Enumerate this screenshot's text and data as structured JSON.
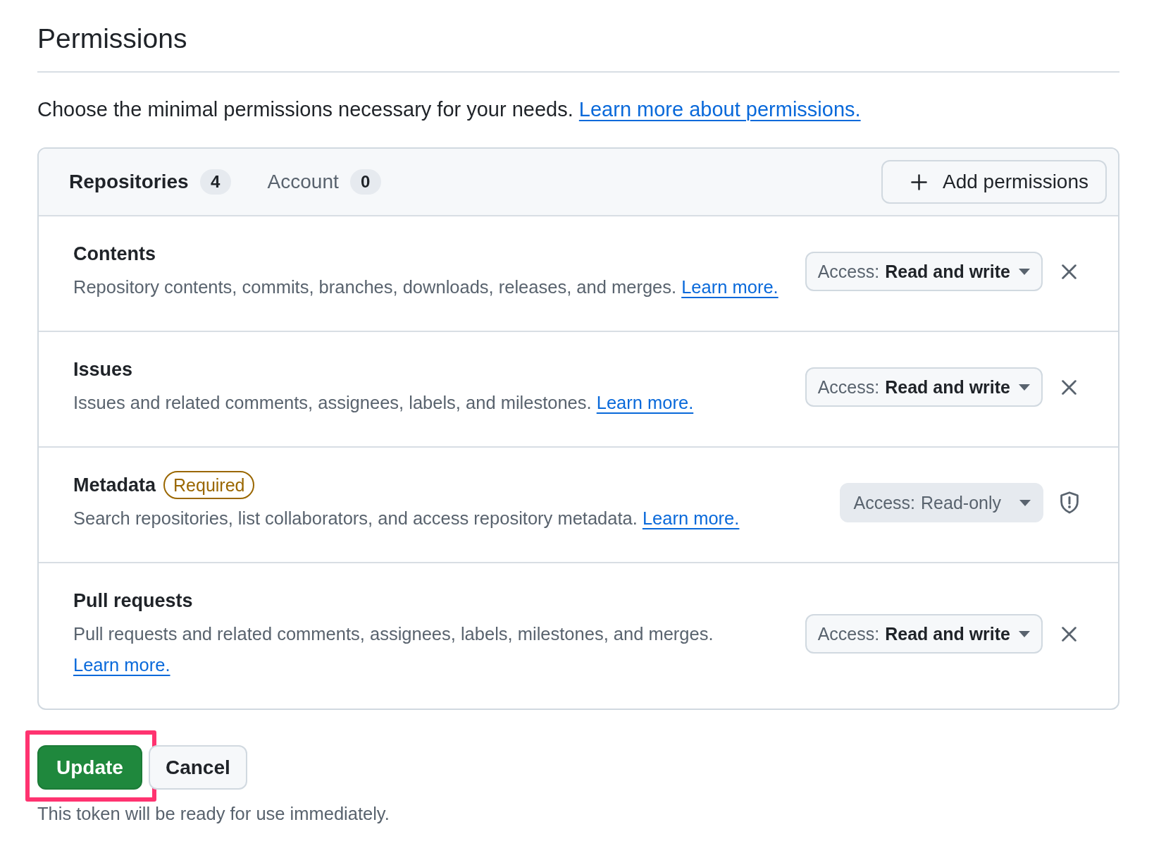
{
  "page": {
    "title": "Permissions",
    "intro": {
      "text": "Choose the minimal permissions necessary for your needs.",
      "link": "Learn more about permissions."
    }
  },
  "panel": {
    "tabs": [
      {
        "label": "Repositories",
        "count": "4",
        "selected": true
      },
      {
        "label": "Account",
        "count": "0",
        "selected": false
      }
    ],
    "add_button": {
      "label": "Add permissions"
    },
    "rows": [
      {
        "name": "Contents",
        "description": "Repository contents, commits, branches, downloads, releases, and merges.",
        "link": "Learn more.",
        "access_prefix": "Access:",
        "access_value": "Read and write",
        "locked": false
      },
      {
        "name": "Issues",
        "description": "Issues and related comments, assignees, labels, and milestones.",
        "link": "Learn more.",
        "access_prefix": "Access:",
        "access_value": "Read and write",
        "locked": false
      },
      {
        "name": "Metadata",
        "badge": "Required",
        "description": "Search repositories, list collaborators, and access repository metadata.",
        "link": "Learn more.",
        "access_prefix": "Access:",
        "access_value": "Read-only",
        "locked": true
      },
      {
        "name": "Pull requests",
        "description": "Pull requests and related comments, assignees, labels, milestones, and merges.",
        "link": "Learn more.",
        "access_prefix": "Access:",
        "access_value": "Read and write",
        "locked": false
      }
    ]
  },
  "actions": [
    {
      "label": "Update",
      "kind": "submit",
      "highlighted": true
    },
    {
      "label": "Cancel",
      "kind": "cancel",
      "highlighted": false
    }
  ],
  "footnote": "This token will be ready for use immediately."
}
